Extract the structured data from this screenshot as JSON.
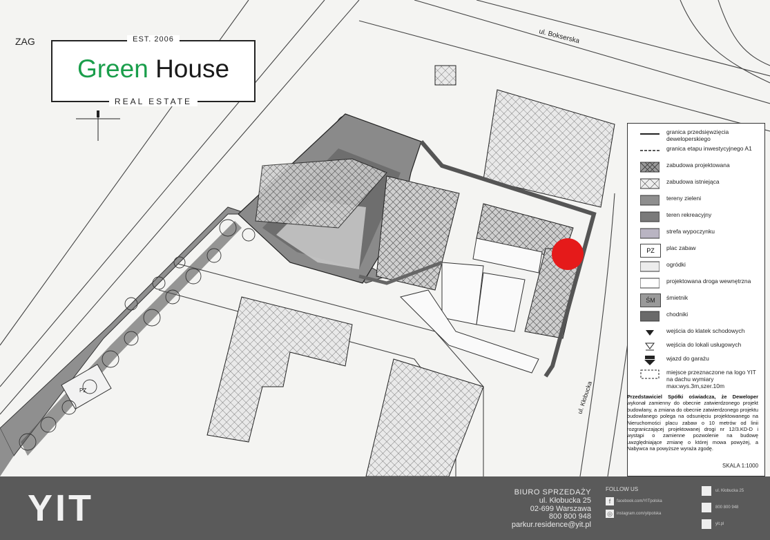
{
  "logo": {
    "prefix": "ZAG",
    "est": "EST. 2006",
    "word_green": "Green",
    "word_house": "House",
    "subtitle": "REAL ESTATE",
    "green_color": "#1a9e4b"
  },
  "map": {
    "street_top": "ul. Bokserska",
    "street_right": "ul. Kłobucka",
    "marker_color": "#e51a1a",
    "playground_label": "PZ"
  },
  "legend": {
    "items": [
      {
        "symbol": "solid-line",
        "label": "granica przedsięwzięcia deweloperskiego"
      },
      {
        "symbol": "dashed-line",
        "label": "granica etapu inwestycyjnego A1"
      },
      {
        "symbol": "dense-hatch",
        "label": "zabudowa projektowana"
      },
      {
        "symbol": "light-hatch",
        "label": "zabudowa istniejąca"
      },
      {
        "symbol": "gray-fill",
        "label": "tereny zieleni"
      },
      {
        "symbol": "gray-fill-2",
        "label": "teren rekreacyjny"
      },
      {
        "symbol": "light-purple",
        "label": "strefa wypoczynku"
      },
      {
        "symbol": "pz-box",
        "code": "PZ",
        "label": "plac zabaw"
      },
      {
        "symbol": "very-light",
        "label": "ogródki"
      },
      {
        "symbol": "white-box",
        "label": "projektowana droga wewnętrzna"
      },
      {
        "symbol": "sm-box",
        "code": "ŚM",
        "label": "śmietnik"
      },
      {
        "symbol": "dark-fill",
        "label": "chodniki"
      },
      {
        "symbol": "triangle-down",
        "label": "wejścia do klatek schodowych"
      },
      {
        "symbol": "triangle-outline",
        "label": "wejścia do lokali usługowych"
      },
      {
        "symbol": "arrow-bar",
        "label": "wjazd do garażu"
      },
      {
        "symbol": "logo-box",
        "label": "miejsce przeznaczone na logo YIT na dachu wymiary max:wys.3m,szer.10m"
      }
    ]
  },
  "declaration": {
    "lead": "Przedstawiciel Spółki oświadcza, że Deweloper",
    "body": "wykonał zamienny do obecnie zatwierdzonego projekt budowlany, a zmiana do obecnie zatwierdzonego projektu budowlanego polega na odsunięciu projektowanego na Nieruchomości placu zabaw o 10 metrów od linii rozgraniczającej projektowanej drogi nr 12/3.KD-D i wystąpi o zamienne pozwolenie na budowę uwzględniające zmianę o której mowa powyżej, a Nabywca na powyższe wyraża zgodę."
  },
  "scale": "SKALA 1:1000",
  "footer": {
    "brand": "YIT",
    "office_title": "BIURO SPRZEDAŻY",
    "address_line1": "ul. Kłobucka 25",
    "address_line2": "02-699 Warszawa",
    "phone": "800 800 948",
    "email": "parkur.residence@yit.pl",
    "follow_us": "FOLLOW US",
    "facebook": "facebook.com/YITpolska",
    "instagram": "instagram.com/yitpolska",
    "right_1": "ul. Kłobucka 25",
    "right_2": "800 800 948",
    "right_3": "yit.pl",
    "bg_color": "#5a5a5a"
  }
}
